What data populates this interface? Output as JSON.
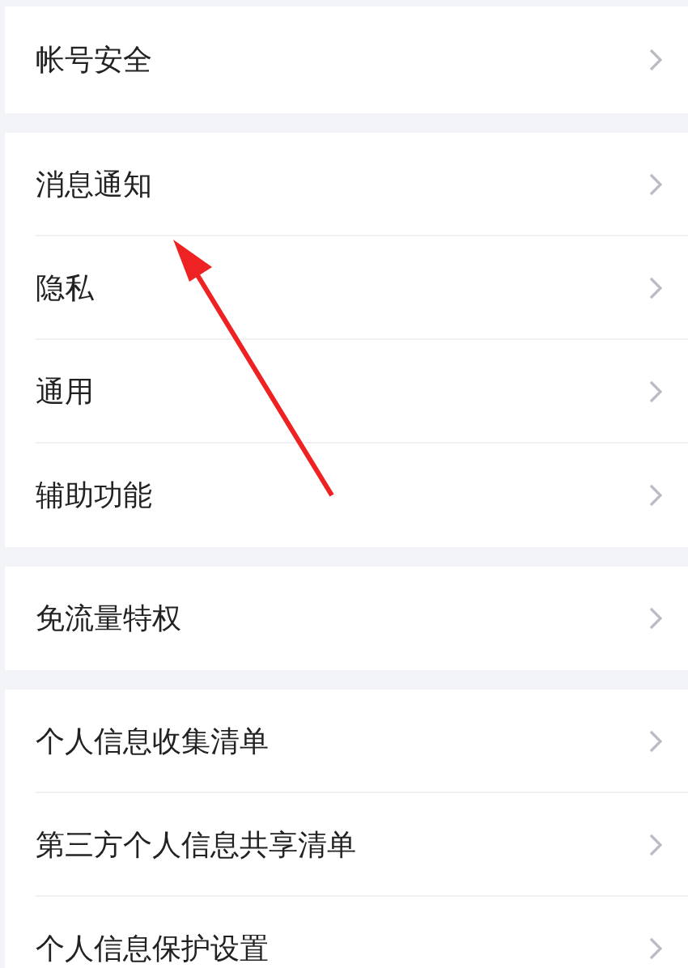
{
  "groups": [
    {
      "items": [
        {
          "label": "帐号安全"
        }
      ]
    },
    {
      "items": [
        {
          "label": "消息通知"
        },
        {
          "label": "隐私"
        },
        {
          "label": "通用"
        },
        {
          "label": "辅助功能"
        }
      ]
    },
    {
      "items": [
        {
          "label": "免流量特权"
        }
      ]
    },
    {
      "items": [
        {
          "label": "个人信息收集清单"
        },
        {
          "label": "第三方个人信息共享清单"
        },
        {
          "label": "个人信息保护设置"
        }
      ]
    }
  ]
}
